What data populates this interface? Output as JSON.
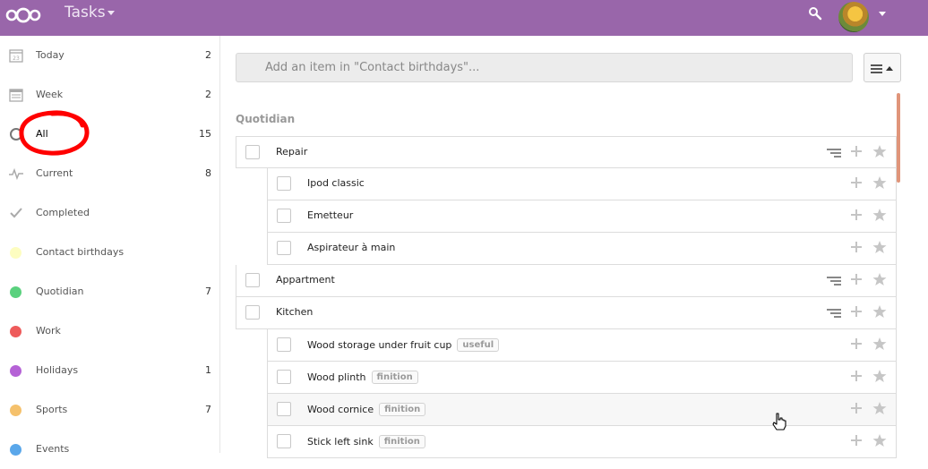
{
  "header": {
    "app_title": "Tasks",
    "brand_color": "#9966aa",
    "icons": [
      "nextcloud-logo",
      "search-icon",
      "user-avatar",
      "chevron-down-icon"
    ]
  },
  "sidebar": {
    "items": [
      {
        "label": "Today",
        "count": "2",
        "icon": "calendar-icon"
      },
      {
        "label": "Week",
        "count": "2",
        "icon": "week-calendar-icon"
      },
      {
        "label": "All",
        "count": "15",
        "icon": "circle-icon"
      },
      {
        "label": "Current",
        "count": "8",
        "icon": "activity-icon"
      },
      {
        "label": "Completed",
        "count": "",
        "icon": "check-icon"
      },
      {
        "label": "Contact birthdays",
        "count": "",
        "color": "#fdfdc0"
      },
      {
        "label": "Quotidian",
        "count": "7",
        "color": "#5ad17e"
      },
      {
        "label": "Work",
        "count": "",
        "color": "#ee5b5b"
      },
      {
        "label": "Holidays",
        "count": "1",
        "color": "#b562d6"
      },
      {
        "label": "Sports",
        "count": "7",
        "color": "#f5c16c"
      },
      {
        "label": "Events",
        "count": "",
        "color": "#5aa7ea"
      }
    ],
    "annotation_color": "#ff0000"
  },
  "main": {
    "add_placeholder": "Add an item in \"Contact birthdays\"...",
    "section_title": "Quotidian",
    "tasks": [
      {
        "title": "Repair",
        "level": 0,
        "has_subtasks": true
      },
      {
        "title": "Ipod classic",
        "level": 1
      },
      {
        "title": "Emetteur",
        "level": 1
      },
      {
        "title": "Aspirateur à main",
        "level": 1
      },
      {
        "title": "Appartment",
        "level": 0,
        "has_subtasks": true
      },
      {
        "title": "Kitchen",
        "level": 0,
        "has_subtasks": true
      },
      {
        "title": "Wood storage under fruit cup",
        "level": 1,
        "tag": "useful"
      },
      {
        "title": "Wood plinth",
        "level": 1,
        "tag": "finition"
      },
      {
        "title": "Wood cornice",
        "level": 1,
        "tag": "finition",
        "hovered": true
      },
      {
        "title": "Stick left sink",
        "level": 1,
        "tag": "finition"
      }
    ],
    "accent_scroll_color": "#e0957a"
  }
}
